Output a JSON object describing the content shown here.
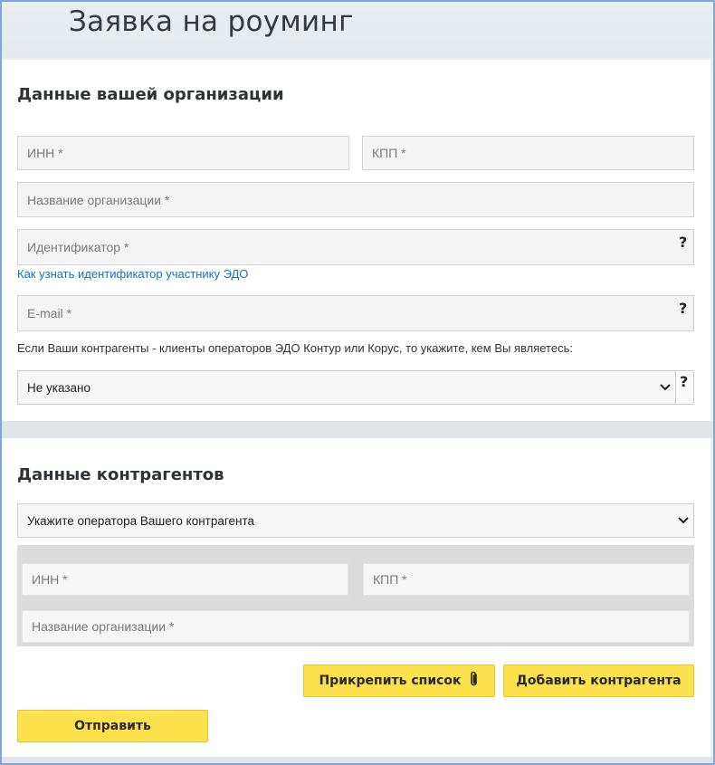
{
  "page": {
    "title": "Заявка на роуминг"
  },
  "org_section": {
    "title": "Данные вашей организации",
    "inn_placeholder": "ИНН *",
    "kpp_placeholder": "КПП *",
    "name_placeholder": "Название организации *",
    "id_placeholder": "Идентификатор *",
    "id_help_link": "Как узнать идентификатор участнику ЭДО",
    "email_placeholder": "E-mail *",
    "operator_note": "Если Ваши контрагенты - клиенты операторов ЭДО Контур или Корус, то укажите, кем Вы являетесь:",
    "role_select_value": "Не указано",
    "help_glyph": "?"
  },
  "contractor_section": {
    "title": "Данные контрагентов",
    "operator_select_value": "Укажите оператора Вашего контрагента",
    "inn_placeholder": "ИНН *",
    "kpp_placeholder": "КПП *",
    "name_placeholder": "Название организации *"
  },
  "actions": {
    "attach_list_label": "Прикрепить список",
    "add_contractor_label": "Добавить контрагента",
    "submit_label": "Отправить"
  },
  "icons": {
    "help": "question-mark-icon",
    "select": "chevron-down-icon",
    "attach": "paperclip-icon"
  },
  "colors": {
    "button": "#fde14d",
    "link": "#1a6fb5",
    "frame": "#7fa6d6"
  }
}
